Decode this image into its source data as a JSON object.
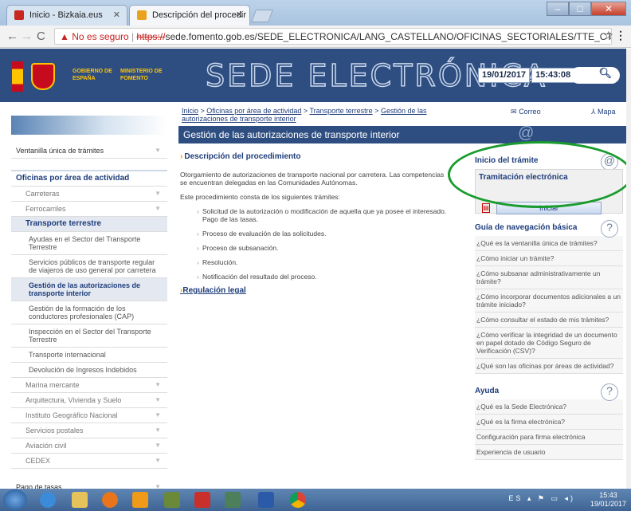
{
  "browser": {
    "tabs": [
      {
        "label": "Inicio - Bizkaia.eus"
      },
      {
        "label": "Descripción del procedir"
      }
    ],
    "url_warning": "No es seguro",
    "url_scheme": "https://",
    "url_rest": "sede.fomento.gob.es/SEDE_ELECTRONICA/LANG_CASTELLANO/OFICINAS_SECTORIALES/TTE_CTRA/GESTION_AU",
    "warning_color": "#c5221f"
  },
  "header": {
    "gov_label": "GOBIERNO DE ESPAÑA",
    "ministry_label": "MINISTERIO DE FOMENTO",
    "site_title": "SEDE ELECTRÓNICA",
    "date": "19/01/2017",
    "time": "15:43:08",
    "brand_color": "#2e4e81"
  },
  "breadcrumb": {
    "items": [
      "Inicio",
      "Oficinas por área de actividad",
      "Transporte terrestre",
      "Gestión de las autorizaciones de transporte interior"
    ],
    "sep": " > "
  },
  "toplinks": {
    "correo": "Correo",
    "mapa": "Mapa"
  },
  "page_title": "Gestión de las autorizaciones de transporte interior",
  "leftnav": {
    "ventanilla": "Ventanilla única de trámites",
    "oficinas": "Oficinas por área de actividad",
    "carreteras": "Carreteras",
    "ferrocarriles": "Ferrocarriles",
    "transporte": "Transporte terrestre",
    "sub": [
      "Ayudas en el Sector del Transporte Terrestre",
      "Servicios públicos de transporte regular de viajeros de uso general por carretera",
      "Gestión de las autorizaciones de transporte interior",
      "Gestión de la formación de los conductores profesionales (CAP)",
      "Inspección en el Sector del Transporte Terrestre",
      "Transporte internacional",
      "Devolución de Ingresos Indebidos"
    ],
    "others": [
      "Marina mercante",
      "Arquitectura, Vivienda y Suelo",
      "Instituto Geográfico Nacional",
      "Servicios postales",
      "Aviación civil",
      "CEDEX"
    ],
    "pago": "Pago de tasas"
  },
  "main": {
    "heading": "Descripción del procedimiento",
    "p1": "Otorgamiento de autorizaciones de transporte nacional por carretera. Las competencias se encuentran delegadas en las Comunidades Autónomas.",
    "p2": "Este procedimiento consta de los siguientes trámites:",
    "steps": [
      "Solicitud de la autorización o modificación de aquella que ya posee el interesado. Pago de las tasas.",
      "Proceso de evaluación de las solicitudes.",
      "Proceso de subsanación.",
      "Resolución.",
      "Notificación del resultado del proceso."
    ],
    "regulacion": "Regulación legal"
  },
  "right": {
    "inicio": "Inicio del trámite",
    "tramitacion": "Tramitación electrónica",
    "iniciar": "Iniciar",
    "guia": "Guía de navegación básica",
    "guia_links": [
      "¿Qué es la ventanilla única de trámites?",
      "¿Cómo iniciar un trámite?",
      "¿Cómo subsanar administrativamente un trámite?",
      "¿Cómo incorporar documentos adicionales a un trámite iniciado?",
      "¿Cómo consultar el estado de mis trámites?",
      "¿Cómo verificar la integridad de un documento en papel dotado de Código Seguro de Verificación (CSV)?",
      "¿Qué son las oficinas por áreas de actividad?"
    ],
    "ayuda": "Ayuda",
    "ayuda_links": [
      "¿Qué es la Sede Electrónica?",
      "¿Qué es la firma electrónica?",
      "Configuración para firma electrónica",
      "Experiencia de usuario"
    ],
    "annotation_color": "#1a9b2e"
  },
  "taskbar": {
    "lang": "ES",
    "time": "15:43",
    "date": "19/01/2017"
  }
}
